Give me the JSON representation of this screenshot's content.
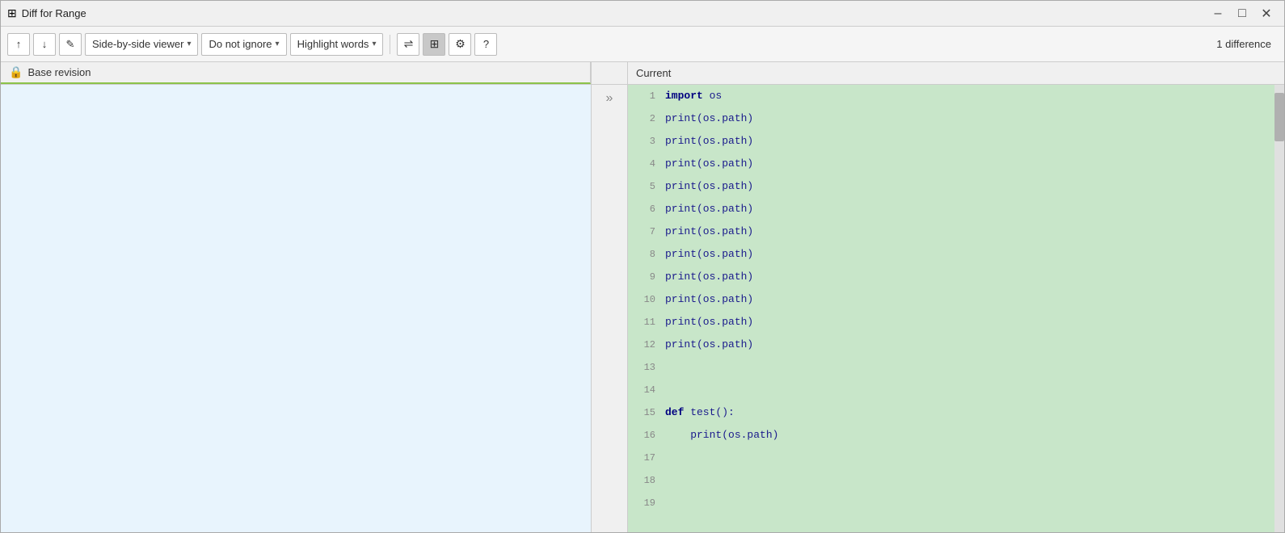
{
  "window": {
    "title": "Diff for Range",
    "icon": "⊞"
  },
  "titlebar": {
    "minimize_label": "–",
    "maximize_label": "□",
    "close_label": "✕"
  },
  "toolbar": {
    "prev_label": "↑",
    "next_label": "↓",
    "edit_label": "✎",
    "viewer_dropdown": "Side-by-side viewer",
    "ignore_dropdown": "Do not ignore",
    "highlight_dropdown": "Highlight words",
    "sync_icon": "sync",
    "columns_icon": "columns",
    "settings_icon": "gear",
    "help_icon": "?",
    "diff_count": "1 difference"
  },
  "headers": {
    "left_label": "Base revision",
    "right_label": "Current"
  },
  "gutter": {
    "arrow": "»"
  },
  "left_pane": {
    "lines": []
  },
  "right_pane": {
    "lines": [
      {
        "num": "1",
        "content": "import os"
      },
      {
        "num": "2",
        "content": "print(os.path)"
      },
      {
        "num": "3",
        "content": "print(os.path)"
      },
      {
        "num": "4",
        "content": "print(os.path)"
      },
      {
        "num": "5",
        "content": "print(os.path)"
      },
      {
        "num": "6",
        "content": "print(os.path)"
      },
      {
        "num": "7",
        "content": "print(os.path)"
      },
      {
        "num": "8",
        "content": "print(os.path)"
      },
      {
        "num": "9",
        "content": "print(os.path)"
      },
      {
        "num": "10",
        "content": "print(os.path)"
      },
      {
        "num": "11",
        "content": "print(os.path)"
      },
      {
        "num": "12",
        "content": "print(os.path)"
      },
      {
        "num": "13",
        "content": ""
      },
      {
        "num": "14",
        "content": ""
      },
      {
        "num": "15",
        "content": "def test():"
      },
      {
        "num": "16",
        "content": "    print(os.path)"
      },
      {
        "num": "17",
        "content": ""
      },
      {
        "num": "18",
        "content": ""
      },
      {
        "num": "19",
        "content": ""
      }
    ]
  }
}
